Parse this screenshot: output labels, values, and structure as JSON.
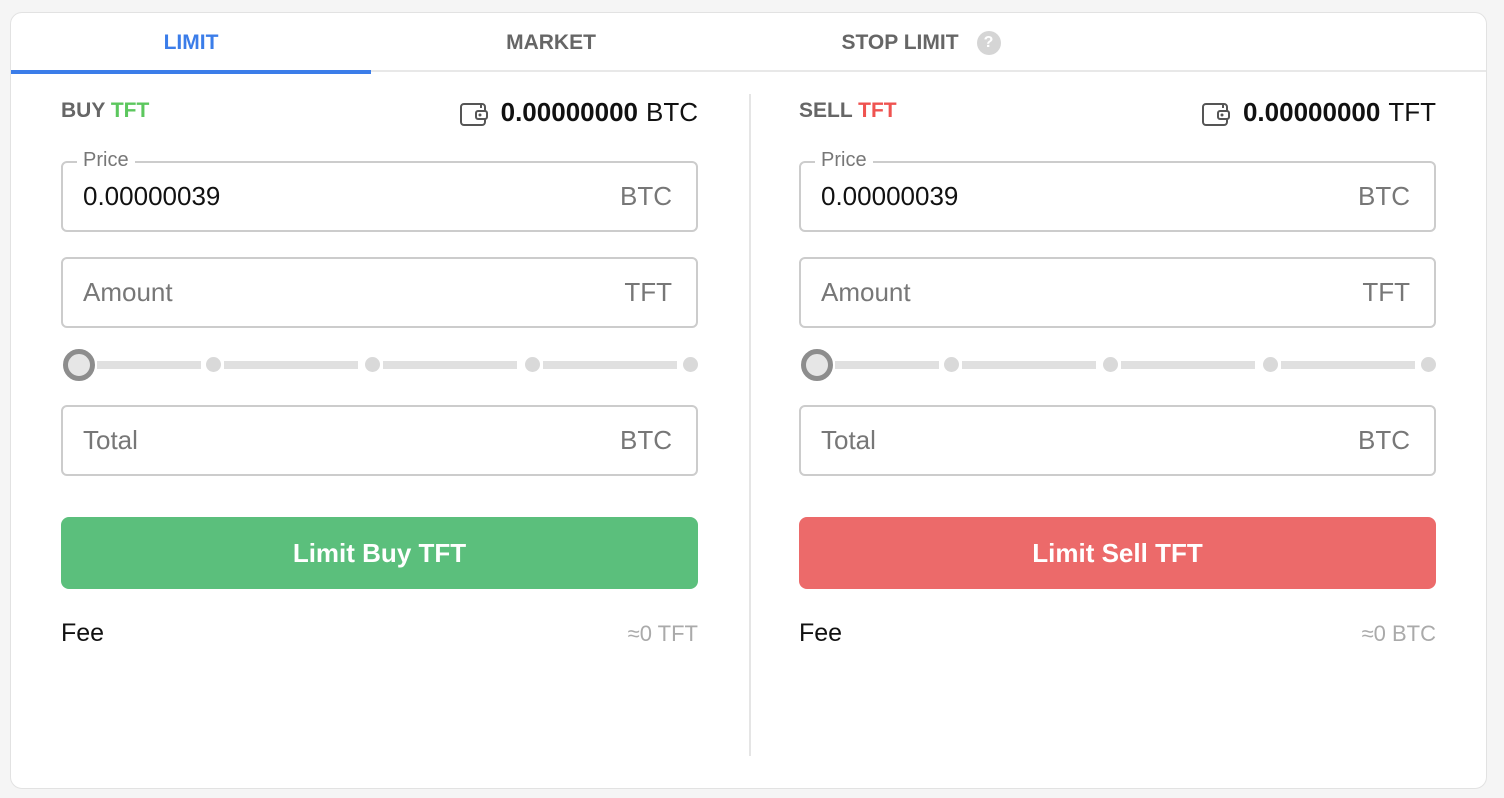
{
  "tabs": [
    {
      "label": "LIMIT",
      "active": true
    },
    {
      "label": "MARKET"
    },
    {
      "label": "STOP LIMIT",
      "help": "?"
    }
  ],
  "colors": {
    "accent": "#3b7de9",
    "buy": "#5bbf7c",
    "sell": "#ec6a6a",
    "buy_text": "#5cc75e",
    "sell_text": "#ef5350"
  },
  "buy": {
    "side": "BUY",
    "asset": "TFT",
    "balance": "0.00000000",
    "balance_unit": "BTC",
    "wallet_icon": "wallet-icon",
    "price_label": "Price",
    "price": "0.00000039",
    "price_unit": "BTC",
    "amount_placeholder": "Amount",
    "amount_unit": "TFT",
    "slider_percent": 0,
    "total_placeholder": "Total",
    "total_unit": "BTC",
    "button": "Limit Buy TFT",
    "fee_label": "Fee",
    "fee_value": "≈0 TFT"
  },
  "sell": {
    "side": "SELL",
    "asset": "TFT",
    "balance": "0.00000000",
    "balance_unit": "TFT",
    "wallet_icon": "wallet-icon",
    "price_label": "Price",
    "price": "0.00000039",
    "price_unit": "BTC",
    "amount_placeholder": "Amount",
    "amount_unit": "TFT",
    "slider_percent": 0,
    "total_placeholder": "Total",
    "total_unit": "BTC",
    "button": "Limit Sell TFT",
    "fee_label": "Fee",
    "fee_value": "≈0 BTC"
  }
}
